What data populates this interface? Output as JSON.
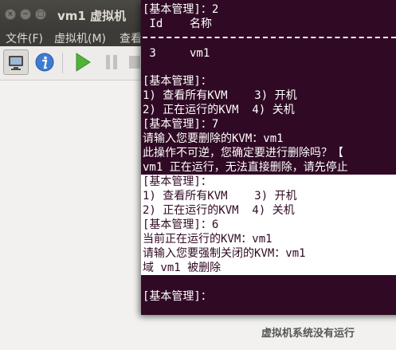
{
  "window": {
    "title": "vm1 虚拟机",
    "close_glyph": "×",
    "minimize_glyph": "−",
    "maximize_glyph": "□"
  },
  "menubar": {
    "file": "文件(F)",
    "vm": "虚拟机(M)",
    "view": "查看"
  },
  "toolbar": {
    "icons": [
      "console-icon",
      "info-icon",
      "run-icon",
      "pause-icon",
      "shutdown-icon"
    ]
  },
  "status": {
    "message": "虚拟机系统没有运行"
  },
  "terminal": {
    "colors": {
      "background": "#300a24",
      "text": "#ffffff",
      "highlight_bg": "#ffffff"
    },
    "lines": [
      "[基本管理]：2",
      " Id    名称",
      "",
      " 3     vm1",
      "",
      "[基本管理]：",
      "1) 查看所有KVM    3) 开机",
      "2) 正在运行的KVM  4) 关机",
      "[基本管理]：7",
      "请输入您要删除的KVM：vm1",
      "此操作不可逆，您确定要进行删除吗？【",
      "vm1 正在运行，无法直接删除，请先停止",
      "[基本管理]：",
      "1) 查看所有KVM    3) 开机",
      "2) 正在运行的KVM  4) 关机",
      "[基本管理]：6",
      "当前正在运行的KVM：vm1",
      "请输入您要强制关闭的KVM：vm1",
      "域 vm1 被删除",
      "",
      "[基本管理]："
    ]
  }
}
